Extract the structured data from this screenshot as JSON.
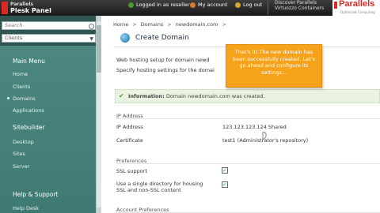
{
  "header": {
    "logo_small": "Parallels",
    "logo_big": "Plesk Panel",
    "logged_in": "Logged in as reseller",
    "my_account": "My account",
    "log_out": "Log out",
    "discover_line1": "Discover Parallels",
    "discover_line2": "Virtuozzo Containers",
    "brand_name": "Parallels",
    "brand_tag": "Optimized Computing"
  },
  "sidebar": {
    "search_placeholder": "Search",
    "clients_select": "Clients",
    "main_menu": "Main Menu",
    "main_items": [
      "Home",
      "Clients",
      "Domains",
      "Applications"
    ],
    "sitebuilder": "Sitebuilder",
    "sitebuilder_items": [
      "Desktop",
      "Sites",
      "Server"
    ],
    "help_support": "Help & Support",
    "help_items": [
      "Help Desk"
    ]
  },
  "main": {
    "breadcrumb": [
      "Home",
      "Domains",
      "newdomain.com"
    ],
    "title": "Create Domain",
    "desc1": "Web hosting setup for domain newd",
    "desc2": "Specify hosting settings for the domai",
    "info_label": "Information:",
    "info_text": "Domain newdomain.com was created.",
    "ip_section": "IP Address",
    "ip_label": "IP Address",
    "ip_value": "123.123.123.124 Shared",
    "cert_label": "Certificate",
    "cert_value": "test1 (Administrator's repository)",
    "pref_section": "Preferences",
    "ssl_label": "SSL support",
    "single_dir_line1": "Use a single directory for housing",
    "single_dir_line2": "SSL and non-SSL content",
    "account_pref": "Account Preferences"
  },
  "tooltip": {
    "text": "That's it! The new domain has been successfully created. Let's go ahead and configure its settings..."
  },
  "colors": {
    "accent_orange": "#f7a21b",
    "sidebar_green": "#4f8a82",
    "brand_red": "#d82a23",
    "info_green": "#eaf3e2"
  }
}
